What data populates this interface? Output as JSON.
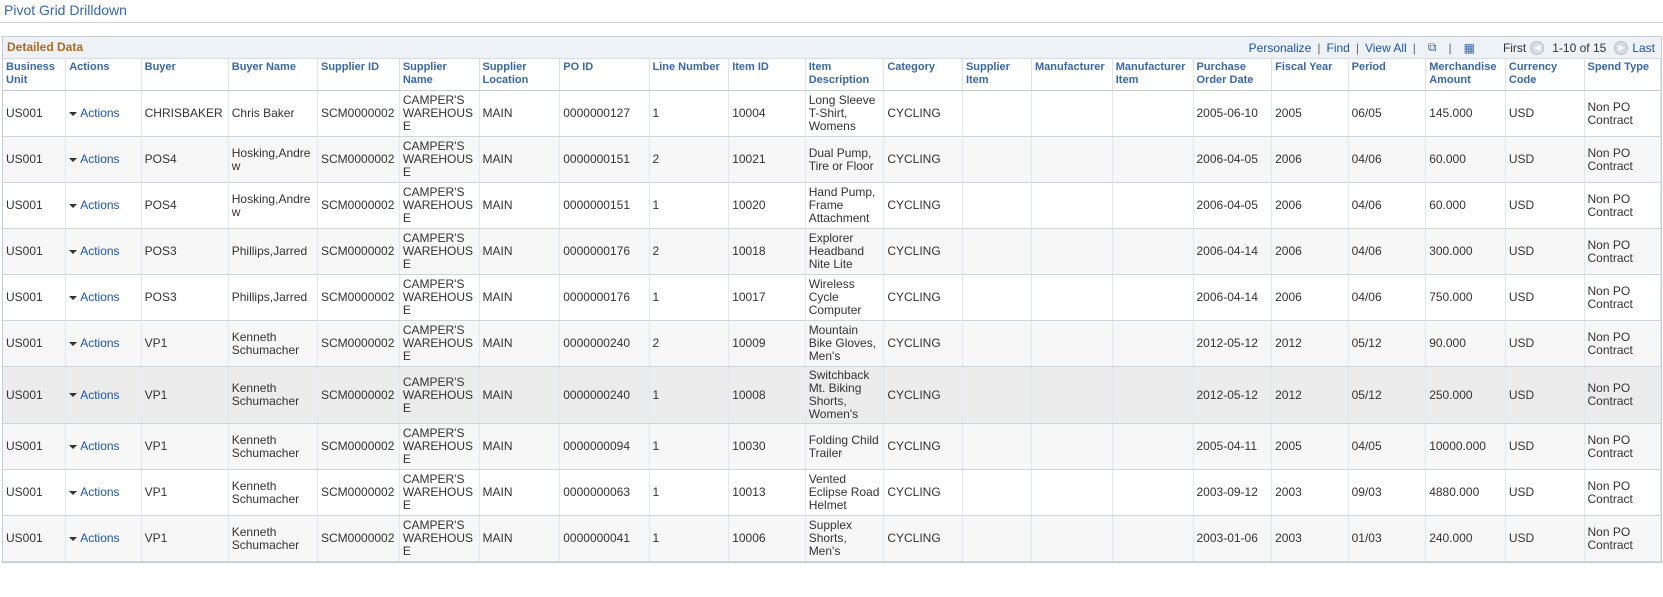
{
  "page": {
    "title": "Pivot Grid Drilldown"
  },
  "grid": {
    "title": "Detailed Data",
    "nav": {
      "personalize": "Personalize",
      "find": "Find",
      "view_all": "View All",
      "first": "First",
      "range": "1-10 of 15",
      "last": "Last"
    },
    "columns": [
      "Business Unit",
      "Actions",
      "Buyer",
      "Buyer Name",
      "Supplier ID",
      "Supplier Name",
      "Supplier Location",
      "PO ID",
      "Line Number",
      "Item ID",
      "Item Description",
      "Category",
      "Supplier Item",
      "Manufacturer",
      "Manufacturer Item",
      "Purchase Order Date",
      "Fiscal Year",
      "Period",
      "Merchandise Amount",
      "Currency Code",
      "Spend Type"
    ],
    "rows": [
      [
        "US001",
        "Actions",
        "CHRISBAKER",
        "Chris Baker",
        "SCM0000002",
        "CAMPER'S WAREHOUSE",
        "MAIN",
        "0000000127",
        "1",
        "10004",
        "Long Sleeve T-Shirt, Womens",
        "CYCLING",
        "",
        "",
        "",
        "2005-06-10",
        "2005",
        "06/05",
        "145.000",
        "USD",
        "Non PO Contract"
      ],
      [
        "US001",
        "Actions",
        "POS4",
        "Hosking,Andrew",
        "SCM0000002",
        "CAMPER'S WAREHOUSE",
        "MAIN",
        "0000000151",
        "2",
        "10021",
        "Dual Pump, Tire or Floor",
        "CYCLING",
        "",
        "",
        "",
        "2006-04-05",
        "2006",
        "04/06",
        "60.000",
        "USD",
        "Non PO Contract"
      ],
      [
        "US001",
        "Actions",
        "POS4",
        "Hosking,Andrew",
        "SCM0000002",
        "CAMPER'S WAREHOUSE",
        "MAIN",
        "0000000151",
        "1",
        "10020",
        "Hand Pump, Frame Attachment",
        "CYCLING",
        "",
        "",
        "",
        "2006-04-05",
        "2006",
        "04/06",
        "60.000",
        "USD",
        "Non PO Contract"
      ],
      [
        "US001",
        "Actions",
        "POS3",
        "Phillips,Jarred",
        "SCM0000002",
        "CAMPER'S WAREHOUSE",
        "MAIN",
        "0000000176",
        "2",
        "10018",
        "Explorer Headband Nite Lite",
        "CYCLING",
        "",
        "",
        "",
        "2006-04-14",
        "2006",
        "04/06",
        "300.000",
        "USD",
        "Non PO Contract"
      ],
      [
        "US001",
        "Actions",
        "POS3",
        "Phillips,Jarred",
        "SCM0000002",
        "CAMPER'S WAREHOUSE",
        "MAIN",
        "0000000176",
        "1",
        "10017",
        "Wireless Cycle Computer",
        "CYCLING",
        "",
        "",
        "",
        "2006-04-14",
        "2006",
        "04/06",
        "750.000",
        "USD",
        "Non PO Contract"
      ],
      [
        "US001",
        "Actions",
        "VP1",
        "Kenneth Schumacher",
        "SCM0000002",
        "CAMPER'S WAREHOUSE",
        "MAIN",
        "0000000240",
        "2",
        "10009",
        "Mountain Bike Gloves, Men's",
        "CYCLING",
        "",
        "",
        "",
        "2012-05-12",
        "2012",
        "05/12",
        "90.000",
        "USD",
        "Non PO Contract"
      ],
      [
        "US001",
        "Actions",
        "VP1",
        "Kenneth Schumacher",
        "SCM0000002",
        "CAMPER'S WAREHOUSE",
        "MAIN",
        "0000000240",
        "1",
        "10008",
        "Switchback Mt. Biking Shorts, Women's",
        "CYCLING",
        "",
        "",
        "",
        "2012-05-12",
        "2012",
        "05/12",
        "250.000",
        "USD",
        "Non PO Contract"
      ],
      [
        "US001",
        "Actions",
        "VP1",
        "Kenneth Schumacher",
        "SCM0000002",
        "CAMPER'S WAREHOUSE",
        "MAIN",
        "0000000094",
        "1",
        "10030",
        "Folding Child Trailer",
        "CYCLING",
        "",
        "",
        "",
        "2005-04-11",
        "2005",
        "04/05",
        "10000.000",
        "USD",
        "Non PO Contract"
      ],
      [
        "US001",
        "Actions",
        "VP1",
        "Kenneth Schumacher",
        "SCM0000002",
        "CAMPER'S WAREHOUSE",
        "MAIN",
        "0000000063",
        "1",
        "10013",
        "Vented Eclipse Road Helmet",
        "CYCLING",
        "",
        "",
        "",
        "2003-09-12",
        "2003",
        "09/03",
        "4880.000",
        "USD",
        "Non PO Contract"
      ],
      [
        "US001",
        "Actions",
        "VP1",
        "Kenneth Schumacher",
        "SCM0000002",
        "CAMPER'S WAREHOUSE",
        "MAIN",
        "0000000041",
        "1",
        "10006",
        "Supplex Shorts, Men's",
        "CYCLING",
        "",
        "",
        "",
        "2003-01-06",
        "2003",
        "01/03",
        "240.000",
        "USD",
        "Non PO Contract"
      ]
    ]
  }
}
